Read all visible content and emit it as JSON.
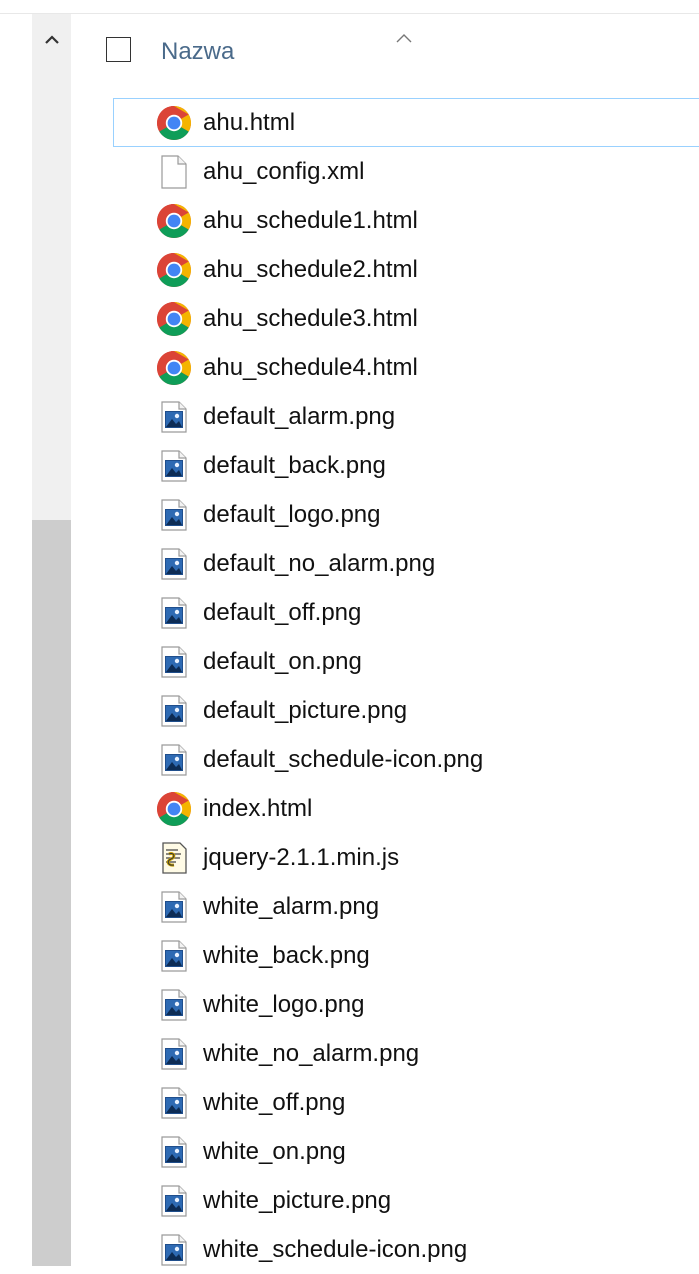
{
  "header": {
    "name_column_label": "Nazwa",
    "sort_indicator": "sort-ascending-icon"
  },
  "files": [
    {
      "name": "ahu.html",
      "icon": "chrome-icon",
      "selected": true
    },
    {
      "name": "ahu_config.xml",
      "icon": "blank-file-icon"
    },
    {
      "name": "ahu_schedule1.html",
      "icon": "chrome-icon"
    },
    {
      "name": "ahu_schedule2.html",
      "icon": "chrome-icon"
    },
    {
      "name": "ahu_schedule3.html",
      "icon": "chrome-icon"
    },
    {
      "name": "ahu_schedule4.html",
      "icon": "chrome-icon"
    },
    {
      "name": "default_alarm.png",
      "icon": "image-file-icon"
    },
    {
      "name": "default_back.png",
      "icon": "image-file-icon"
    },
    {
      "name": "default_logo.png",
      "icon": "image-file-icon"
    },
    {
      "name": "default_no_alarm.png",
      "icon": "image-file-icon"
    },
    {
      "name": "default_off.png",
      "icon": "image-file-icon"
    },
    {
      "name": "default_on.png",
      "icon": "image-file-icon"
    },
    {
      "name": "default_picture.png",
      "icon": "image-file-icon"
    },
    {
      "name": "default_schedule-icon.png",
      "icon": "image-file-icon"
    },
    {
      "name": "index.html",
      "icon": "chrome-icon"
    },
    {
      "name": "jquery-2.1.1.min.js",
      "icon": "script-file-icon"
    },
    {
      "name": "white_alarm.png",
      "icon": "image-file-icon"
    },
    {
      "name": "white_back.png",
      "icon": "image-file-icon"
    },
    {
      "name": "white_logo.png",
      "icon": "image-file-icon"
    },
    {
      "name": "white_no_alarm.png",
      "icon": "image-file-icon"
    },
    {
      "name": "white_off.png",
      "icon": "image-file-icon"
    },
    {
      "name": "white_on.png",
      "icon": "image-file-icon"
    },
    {
      "name": "white_picture.png",
      "icon": "image-file-icon"
    },
    {
      "name": "white_schedule-icon.png",
      "icon": "image-file-icon"
    }
  ],
  "colors": {
    "selection_border": "#99d1ff",
    "header_text": "#4a6a8a",
    "scrollbar_track": "#f0f0f0",
    "scrollbar_thumb": "#cdcdcd"
  }
}
